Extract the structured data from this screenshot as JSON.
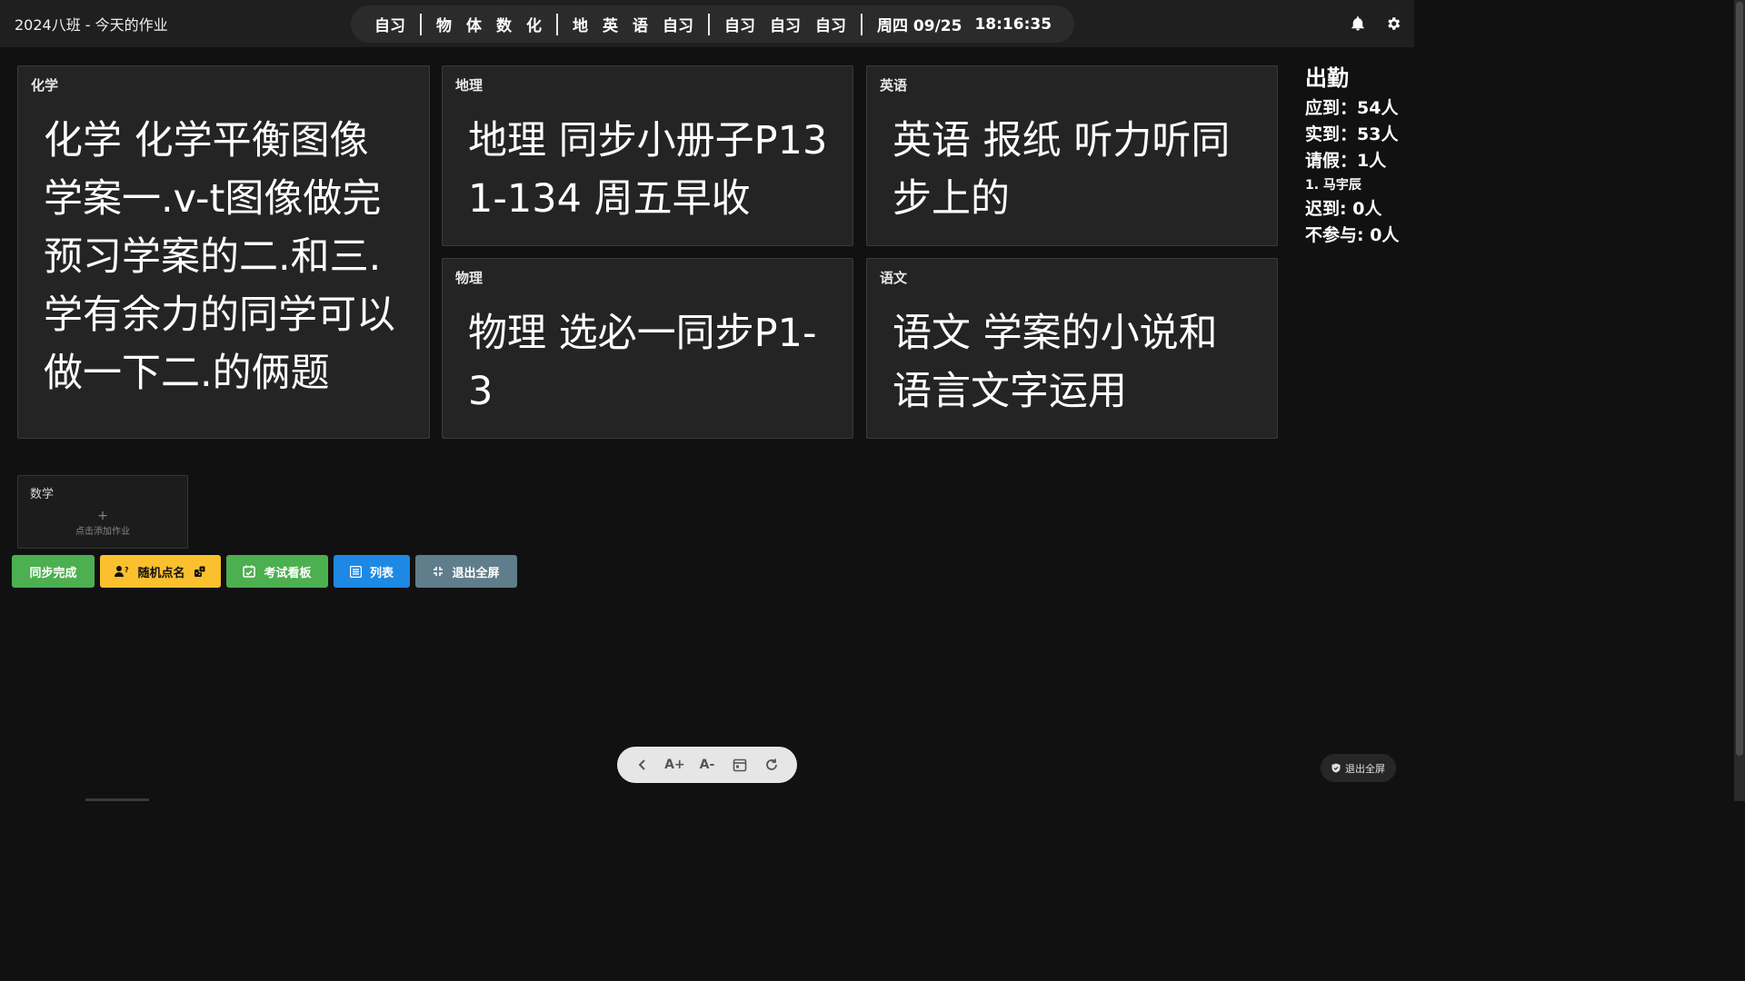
{
  "header": {
    "title": "2024八班 - 今天的作业",
    "schedule": [
      "自习",
      "物",
      "体",
      "数",
      "化",
      "地",
      "英",
      "语",
      "自习",
      "自习",
      "自习",
      "自习"
    ],
    "date": "周四 09/25",
    "time": "18:16:35"
  },
  "cards": [
    {
      "subject": "化学",
      "content": "化学 化学平衡图像学案一.v-t图像做完 预习学案的二.和三. 学有余力的同学可以做一下二.的俩题"
    },
    {
      "subject": "地理",
      "content": "地理 同步小册子P131-134 周五早收"
    },
    {
      "subject": "英语",
      "content": "英语 报纸 听力听同步上的"
    },
    {
      "subject": "物理",
      "content": "物理 选必一同步P1-3"
    },
    {
      "subject": "语文",
      "content": "语文 学案的小说和语言文字运用"
    }
  ],
  "empty_card": {
    "subject": "数学",
    "plus": "+",
    "hint": "点击添加作业"
  },
  "buttons": {
    "sync_done": "同步完成",
    "random_call": "随机点名",
    "exam_board": "考试看板",
    "list": "列表",
    "exit_fullscreen": "退出全屏"
  },
  "attendance": {
    "title": "出勤",
    "expected": "应到：54人",
    "actual": "实到：53人",
    "leave": "请假：1人",
    "leave_names": [
      "1. 马宇辰"
    ],
    "late": "迟到: 0人",
    "absent": "不参与: 0人"
  },
  "toolbar": {
    "font_inc": "A+",
    "font_dec": "A-"
  },
  "exit_pill": {
    "label": "退出全屏"
  },
  "colors": {
    "background": "#111111",
    "card": "#242424",
    "sync_btn": "#4caf50",
    "random_btn": "#fbc02d",
    "exam_btn": "#4caf50",
    "list_btn": "#1e88e5",
    "exit_btn": "#607d8b"
  }
}
